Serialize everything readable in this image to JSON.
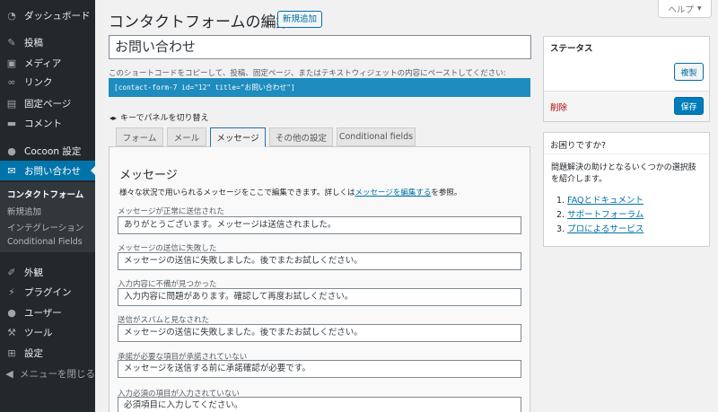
{
  "sidebar": {
    "items": [
      {
        "label": "ダッシュボード",
        "icon": "dashboard-icon"
      },
      {
        "label": "投稿",
        "icon": "pin-icon"
      },
      {
        "label": "メディア",
        "icon": "media-icon"
      },
      {
        "label": "リンク",
        "icon": "link-icon"
      },
      {
        "label": "固定ページ",
        "icon": "page-icon"
      },
      {
        "label": "コメント",
        "icon": "comment-icon"
      },
      {
        "label": "Cocoon 設定",
        "icon": "cocoon-icon"
      },
      {
        "label": "お問い合わせ",
        "icon": "mail-icon"
      },
      {
        "label": "外観",
        "icon": "brush-icon"
      },
      {
        "label": "プラグイン",
        "icon": "plugin-icon"
      },
      {
        "label": "ユーザー",
        "icon": "user-icon"
      },
      {
        "label": "ツール",
        "icon": "tool-icon"
      },
      {
        "label": "設定",
        "icon": "settings-icon"
      },
      {
        "label": "メニューを閉じる",
        "icon": "collapse-icon"
      }
    ],
    "submenu": [
      "コンタクトフォーム",
      "新規追加",
      "インテグレーション",
      "Conditional Fields"
    ]
  },
  "header": {
    "title": "コンタクトフォームの編集",
    "add_new": "新規追加",
    "help": "ヘルプ"
  },
  "form": {
    "title_value": "お問い合わせ",
    "shortcode_desc": "このショートコードをコピーして、投稿、固定ページ、またはテキストウィジェットの内容にペーストしてください:",
    "shortcode": "[contact-form-7 id=\"12\" title=\"お問い合わせ\"]",
    "kbd_hint": "キーでパネルを切り替え"
  },
  "tabs": [
    "フォーム",
    "メール",
    "メッセージ",
    "その他の設定",
    "Conditional fields"
  ],
  "panel": {
    "heading": "メッセージ",
    "desc_before": "様々な状況で用いられるメッセージをここで編集できます。詳しくは",
    "desc_link": "メッセージを編集する",
    "desc_after": "を参照。",
    "fields": [
      {
        "label": "メッセージが正常に送信された",
        "value": "ありがとうございます。メッセージは送信されました。"
      },
      {
        "label": "メッセージの送信に失敗した",
        "value": "メッセージの送信に失敗しました。後でまたお試しください。"
      },
      {
        "label": "入力内容に不備が見つかった",
        "value": "入力内容に問題があります。確認して再度お試しください。"
      },
      {
        "label": "送信がスパムと見なされた",
        "value": "メッセージの送信に失敗しました。後でまたお試しください。"
      },
      {
        "label": "承諾が必要な項目が承諾されていない",
        "value": "メッセージを送信する前に承諾確認が必要です。"
      },
      {
        "label": "入力必須の項目が入力されていない",
        "value": "必須項目に入力してください。"
      }
    ]
  },
  "status": {
    "title": "ステータス",
    "copy": "複製",
    "delete": "削除",
    "save": "保存"
  },
  "help_box": {
    "title": "お困りですか?",
    "desc": "問題解決の助けとなるいくつかの選択肢を紹介します。",
    "links": [
      {
        "num": "1.",
        "link": "FAQとドキュメント"
      },
      {
        "num": "2.",
        "link": "サポートフォーラム"
      },
      {
        "num": "3.",
        "link": "プロによるサービス"
      }
    ]
  },
  "colors": {
    "sidebar": "#23282d",
    "active": "#0073aa",
    "shortcode_bg": "#1e8cbe",
    "save": "#007cba",
    "delete": "#aa0000"
  }
}
